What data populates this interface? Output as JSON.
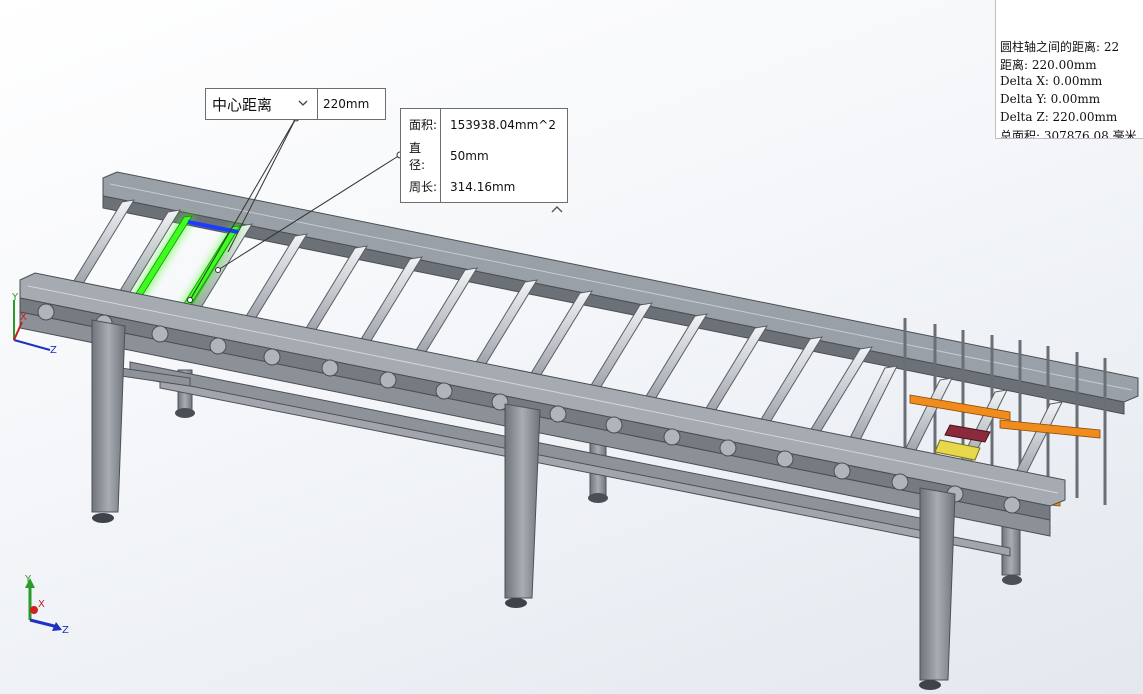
{
  "distance_callout": {
    "type_label": "中心距离",
    "value": "220mm"
  },
  "properties_callout": {
    "rows": [
      {
        "label": "面积:",
        "value": "153938.04mm^2"
      },
      {
        "label": "直 径:",
        "value": "50mm"
      },
      {
        "label": "周长:",
        "value": "314.16mm"
      }
    ]
  },
  "results_panel": {
    "lines": [
      "圆柱轴之间的距离: 22",
      "距离: 220.00mm",
      "Delta X: 0.00mm",
      "Delta Y: 0.00mm",
      "Delta Z: 220.00mm",
      "总面积: 307876.08 毫米"
    ]
  },
  "triad_small": {
    "x": "X",
    "y": "Y",
    "z": "Z"
  },
  "triad_main": {
    "y": "Y",
    "x": "X",
    "z": "Z"
  },
  "colors": {
    "frame": "#8a8f96",
    "roller": "#c4c8cc",
    "highlight": "#39ff14",
    "accent_orange": "#f08c1e"
  }
}
